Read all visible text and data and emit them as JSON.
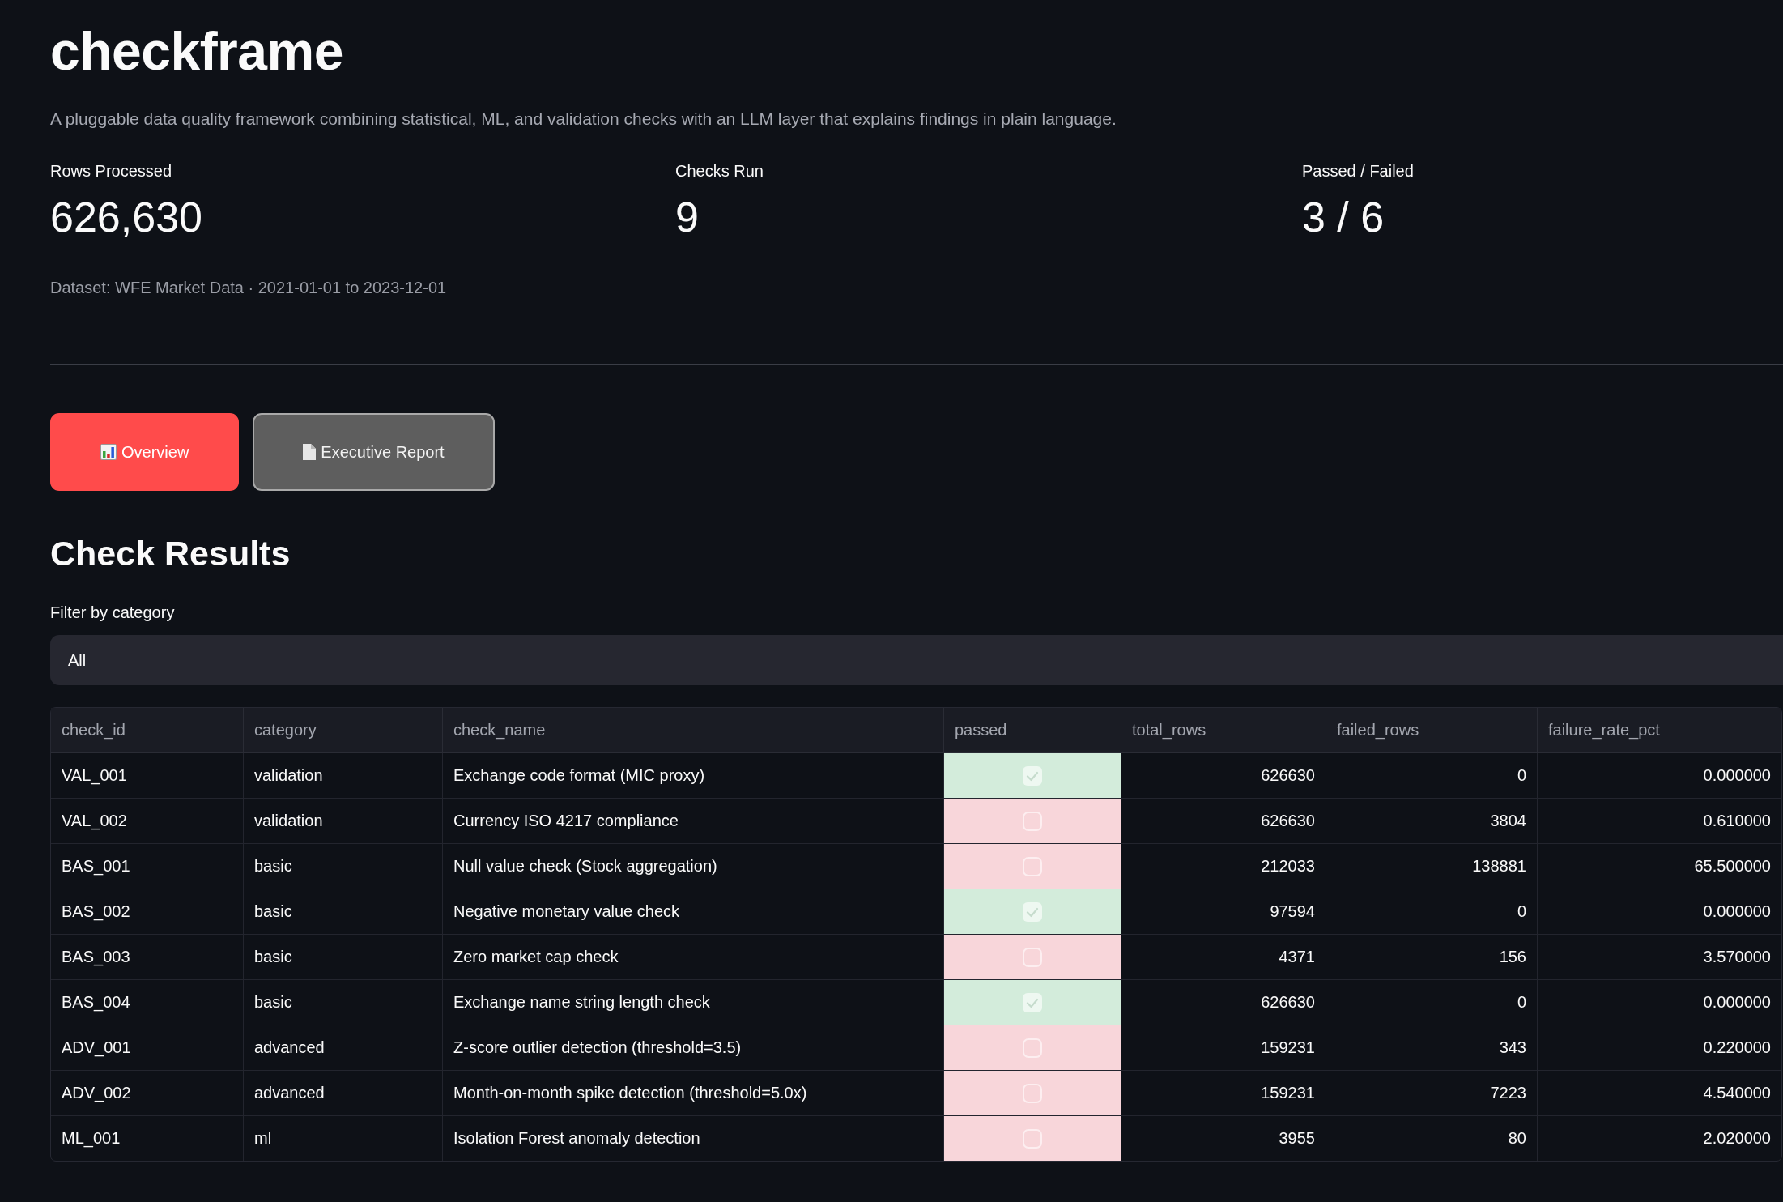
{
  "header": {
    "title": "checkframe",
    "description": "A pluggable data quality framework combining statistical, ML, and validation checks with an LLM layer that explains findings in plain language."
  },
  "metrics": [
    {
      "label": "Rows Processed",
      "value": "626,630"
    },
    {
      "label": "Checks Run",
      "value": "9"
    },
    {
      "label": "Passed / Failed",
      "value": "3 / 6"
    }
  ],
  "dataset_caption": "Dataset: WFE Market Data · 2021-01-01 to 2023-12-01",
  "nav_buttons": [
    {
      "label": "Overview",
      "selected": true
    },
    {
      "label": "Executive Report",
      "selected": false
    }
  ],
  "check_results": {
    "heading": "Check Results",
    "filter": {
      "label": "Filter by category",
      "value": "All"
    },
    "table": {
      "columns": [
        "check_id",
        "category",
        "check_name",
        "passed",
        "total_rows",
        "failed_rows",
        "failure_rate_pct"
      ],
      "rows": [
        {
          "check_id": "VAL_001",
          "category": "validation",
          "check_name": "Exchange code format (MIC proxy)",
          "passed": true,
          "total_rows": "626630",
          "failed_rows": "0",
          "failure_rate_pct": "0.000000"
        },
        {
          "check_id": "VAL_002",
          "category": "validation",
          "check_name": "Currency ISO 4217 compliance",
          "passed": false,
          "total_rows": "626630",
          "failed_rows": "3804",
          "failure_rate_pct": "0.610000"
        },
        {
          "check_id": "BAS_001",
          "category": "basic",
          "check_name": "Null value check (Stock aggregation)",
          "passed": false,
          "total_rows": "212033",
          "failed_rows": "138881",
          "failure_rate_pct": "65.500000"
        },
        {
          "check_id": "BAS_002",
          "category": "basic",
          "check_name": "Negative monetary value check",
          "passed": true,
          "total_rows": "97594",
          "failed_rows": "0",
          "failure_rate_pct": "0.000000"
        },
        {
          "check_id": "BAS_003",
          "category": "basic",
          "check_name": "Zero market cap check",
          "passed": false,
          "total_rows": "4371",
          "failed_rows": "156",
          "failure_rate_pct": "3.570000"
        },
        {
          "check_id": "BAS_004",
          "category": "basic",
          "check_name": "Exchange name string length check",
          "passed": true,
          "total_rows": "626630",
          "failed_rows": "0",
          "failure_rate_pct": "0.000000"
        },
        {
          "check_id": "ADV_001",
          "category": "advanced",
          "check_name": "Z-score outlier detection (threshold=3.5)",
          "passed": false,
          "total_rows": "159231",
          "failed_rows": "343",
          "failure_rate_pct": "0.220000"
        },
        {
          "check_id": "ADV_002",
          "category": "advanced",
          "check_name": "Month-on-month spike detection (threshold=5.0x)",
          "passed": false,
          "total_rows": "159231",
          "failed_rows": "7223",
          "failure_rate_pct": "4.540000"
        },
        {
          "check_id": "ML_001",
          "category": "ml",
          "check_name": "Isolation Forest anomaly detection",
          "passed": false,
          "total_rows": "3955",
          "failed_rows": "80",
          "failure_rate_pct": "2.020000"
        }
      ]
    }
  }
}
